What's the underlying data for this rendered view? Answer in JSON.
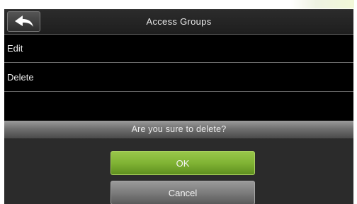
{
  "header": {
    "title": "Access Groups",
    "back_icon": "back-arrow-icon"
  },
  "menu": {
    "items": [
      {
        "label": "Edit"
      },
      {
        "label": "Delete"
      }
    ]
  },
  "dialog": {
    "message": "Are you sure to delete?",
    "ok_label": "OK",
    "cancel_label": "Cancel"
  },
  "colors": {
    "ok_button": "#80b334",
    "cancel_button": "#7c7c7c",
    "background": "#000000"
  }
}
